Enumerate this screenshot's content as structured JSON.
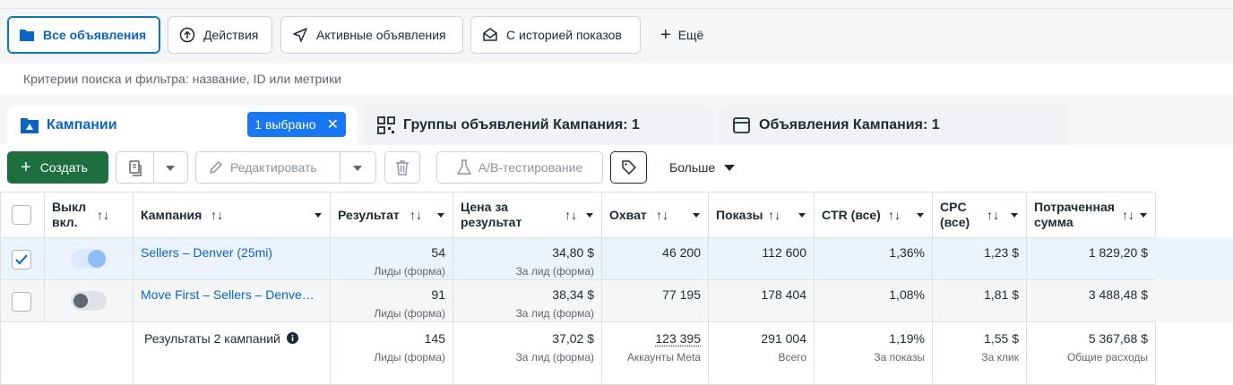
{
  "views": [
    {
      "label": "Все объявления",
      "icon": "folder-icon"
    },
    {
      "label": "Действия",
      "icon": "upload-circle-icon"
    },
    {
      "label": "Активные объявления",
      "icon": "send-icon"
    },
    {
      "label": "С историей показов",
      "icon": "inbox-icon"
    },
    {
      "label": "Ещё",
      "icon": "plus-icon"
    }
  ],
  "search": {
    "placeholder": "Критерии поиска и фильтра: название, ID или метрики"
  },
  "tabs": {
    "campaigns": "Кампании",
    "selected_badge": "1 выбрано",
    "adsets": "Группы объявлений Кампания: 1",
    "ads": "Объявления Кампания: 1"
  },
  "toolbar": {
    "create": "Создать",
    "edit": "Редактировать",
    "ab_test": "A/B-тестирование",
    "more": "Больше"
  },
  "table": {
    "headers": {
      "toggle": "Выкл вкл.",
      "campaign": "Кампания",
      "result": "Результат",
      "cost": "Цена за результат",
      "reach": "Охват",
      "impressions": "Показы",
      "ctr": "CTR (все)",
      "cpc": "CPC (все)",
      "spent": "Потраченная сумма"
    },
    "rows": [
      {
        "campaign": "Sellers – Denver (25mi)",
        "result": "54",
        "result_sub": "Лиды (форма)",
        "cost": "34,80 $",
        "cost_sub": "За лид (форма)",
        "reach": "46 200",
        "impressions": "112 600",
        "ctr": "1,36%",
        "cpc": "1,23 $",
        "spent": "1 829,20 $"
      },
      {
        "campaign": "Move First – Sellers – Denve…",
        "result": "91",
        "result_sub": "Лиды (форма)",
        "cost": "38,34 $",
        "cost_sub": "За лид (форма)",
        "reach": "77 195",
        "impressions": "178 404",
        "ctr": "1,08%",
        "cpc": "1,81 $",
        "spent": "3 488,48 $"
      }
    ],
    "totals": {
      "label": "Результаты 2 кампаний",
      "result": "145",
      "result_sub": "Лиды (форма)",
      "cost": "37,02 $",
      "cost_sub": "За лид (форма)",
      "reach": "123 395",
      "reach_sub": "Аккаунты Meta",
      "impressions": "291 004",
      "impressions_sub": "Всего",
      "ctr": "1,19%",
      "ctr_sub": "За показы",
      "cpc": "1,55 $",
      "cpc_sub": "За клик",
      "spent": "5 367,68 $",
      "spent_sub": "Общие расходы"
    }
  },
  "colors": {
    "accent": "#0a66c2",
    "create": "#1e6f3f",
    "badge": "#1877f2"
  }
}
